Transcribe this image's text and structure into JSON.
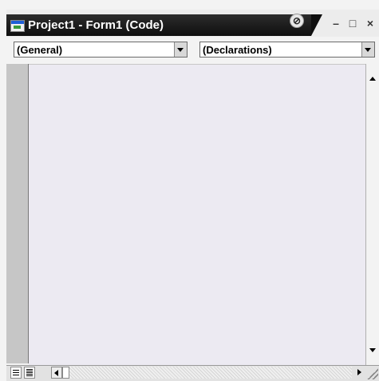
{
  "window": {
    "title": "Project1 - Form1 (Code)",
    "pin_glyph": "⊘",
    "minimize_glyph": "–",
    "maximize_glyph": "□",
    "close_glyph": "×"
  },
  "object_dropdown": {
    "value": "(General)"
  },
  "procedure_dropdown": {
    "value": "(Declarations)"
  },
  "editor": {
    "text": ""
  },
  "colors": {
    "titlebar": "#0f0f0f",
    "code_background": "#eceaf2",
    "gutter": "#c6c6c6",
    "icon_blue": "#1f5fd6"
  },
  "icons": {
    "app": "vb-form-icon",
    "pin": "pin-icon",
    "procedure_view": "procedure-view-icon",
    "full_module_view": "full-module-view-icon"
  }
}
